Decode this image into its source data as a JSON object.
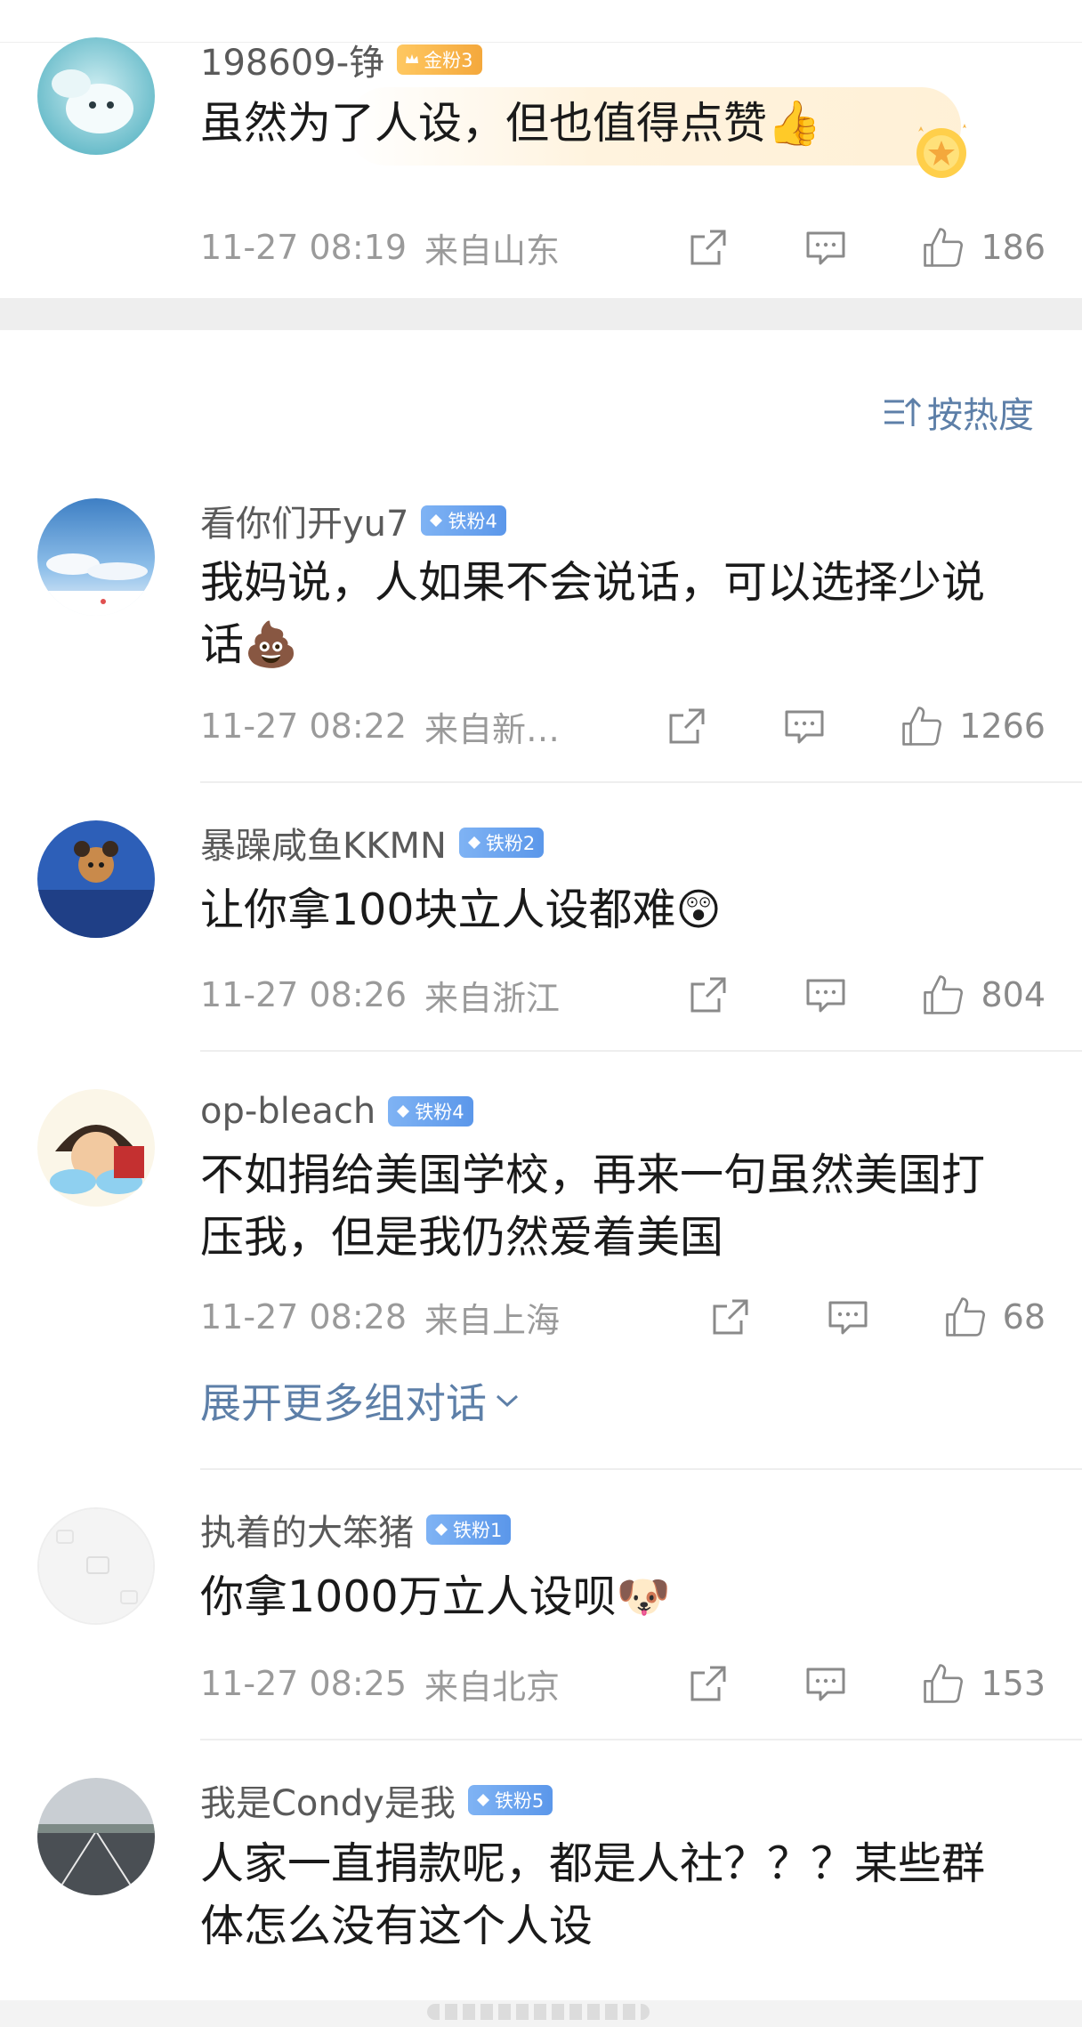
{
  "sort": {
    "label": "按热度",
    "icon": "sort-icon"
  },
  "expand": {
    "label": "展开更多组对话",
    "icon": "chevron-down-icon"
  },
  "comments": [
    {
      "name": "198609-铮",
      "badge": "金粉3",
      "badge_color": "#f4a83c",
      "text": "虽然为了人设，但也值得点赞👍",
      "time": "11-27 08:19",
      "location": "来自山东",
      "likes": "186"
    },
    {
      "name": "看你们开yu7",
      "badge": "铁粉4",
      "badge_color": "#5b97ea",
      "text": "我妈说，人如果不会说话，可以选择少说话💩",
      "time": "11-27 08:22",
      "location": "来自新…",
      "likes": "1266"
    },
    {
      "name": "暴躁咸鱼KKMN",
      "badge": "铁粉2",
      "badge_color": "#5b97ea",
      "text": "让你拿100块立人设都难😲",
      "time": "11-27 08:26",
      "location": "来自浙江",
      "likes": "804"
    },
    {
      "name": "op-bleach",
      "badge": "铁粉4",
      "badge_color": "#5b97ea",
      "text": "不如捐给美国学校，再来一句虽然美国打压我，但是我仍然爱着美国",
      "time": "11-27 08:28",
      "location": "来自上海",
      "likes": "68"
    },
    {
      "name": "执着的大笨猪",
      "badge": "铁粉1",
      "badge_color": "#5b97ea",
      "text": "你拿1000万立人设呗🐶",
      "time": "11-27 08:25",
      "location": "来自北京",
      "likes": "153"
    },
    {
      "name": "我是Condy是我",
      "badge": "铁粉5",
      "badge_color": "#5b97ea",
      "text": "人家一直捐款呢，都是人社？？？某些群体怎么没有这个人设",
      "time": "",
      "location": "",
      "likes": ""
    }
  ],
  "icons": {
    "share": "share-icon",
    "reply": "comment-icon",
    "like": "thumbs-up-icon"
  }
}
